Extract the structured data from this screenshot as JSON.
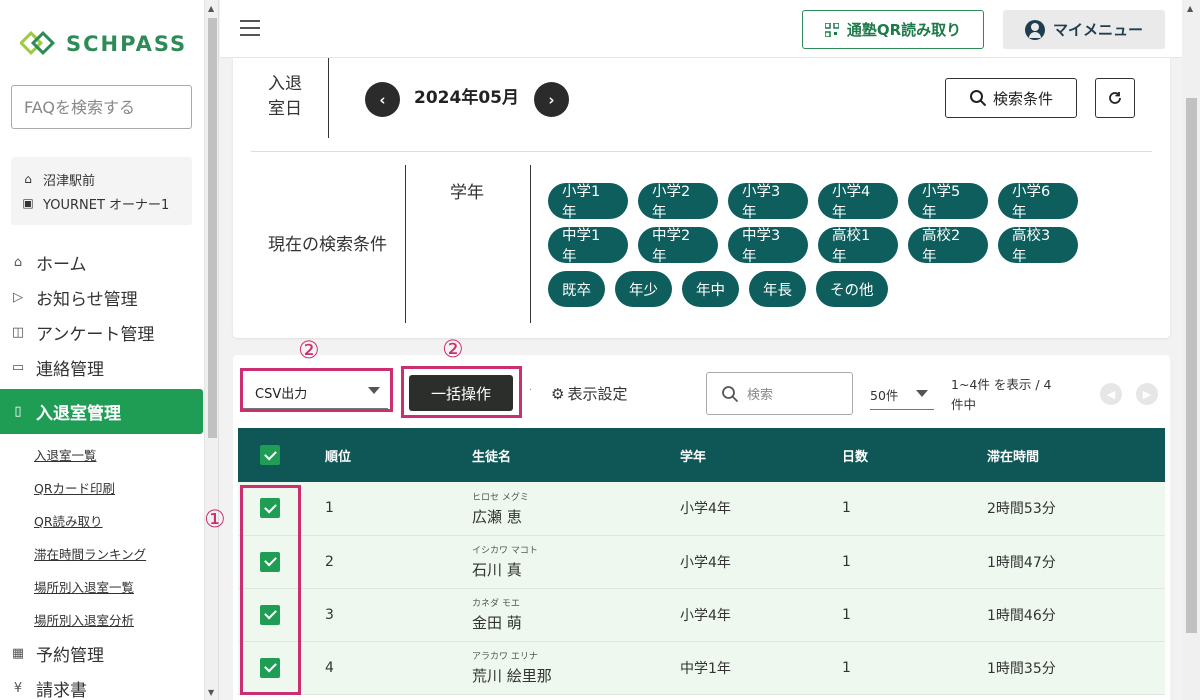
{
  "sidebar": {
    "logo_text": "SCHPASS",
    "faq_placeholder": "FAQを検索する",
    "school": "沼津駅前",
    "owner": "YOURNET オーナー1",
    "nav": [
      {
        "label": "ホーム",
        "icon": "home-icon"
      },
      {
        "label": "お知らせ管理",
        "icon": "triangle-icon"
      },
      {
        "label": "アンケート管理",
        "icon": "survey-icon"
      },
      {
        "label": "連絡管理",
        "icon": "chat-icon"
      },
      {
        "label": "入退室管理",
        "icon": "door-icon"
      }
    ],
    "sub_items": [
      "入退室一覧",
      "QRカード印刷",
      "QR読み取り",
      "滞在時間ランキング",
      "場所別入退室一覧",
      "場所別入退室分析"
    ],
    "nav_after": [
      {
        "label": "予約管理",
        "icon": "calendar-icon"
      },
      {
        "label": "請求書",
        "icon": "yen-icon"
      }
    ]
  },
  "header": {
    "qr_label": "通塾QR読み取り",
    "menu_label": "マイメニュー"
  },
  "search": {
    "date_label_1": "入退",
    "date_label_2": "室日",
    "month": "2024年05月",
    "prev": "‹",
    "next": "›",
    "cond_button": "検索条件",
    "current_label": "現在の検索条件",
    "grade_label": "学年",
    "grades": [
      "小学1年",
      "小学2年",
      "小学3年",
      "小学4年",
      "小学5年",
      "小学6年",
      "中学1年",
      "中学2年",
      "中学3年",
      "高校1年",
      "高校2年",
      "高校3年",
      "既卒",
      "年少",
      "年中",
      "年長",
      "その他"
    ]
  },
  "toolbar": {
    "csv_label": "CSV出力",
    "bulk_label": "一括操作",
    "dot": "·",
    "display_settings": "表示設定",
    "search_placeholder": "検索",
    "per_page": "50件",
    "range_1": "1~4件 を表示 / 4",
    "range_2": "件中"
  },
  "table": {
    "columns": [
      "順位",
      "生徒名",
      "学年",
      "日数",
      "滞在時間"
    ],
    "rows": [
      {
        "rank": "1",
        "kana": "ヒロセ メグミ",
        "name": "広瀬 恵",
        "grade": "小学4年",
        "days": "1",
        "time": "2時間53分"
      },
      {
        "rank": "2",
        "kana": "イシカワ マコト",
        "name": "石川 真",
        "grade": "小学4年",
        "days": "1",
        "time": "1時間47分"
      },
      {
        "rank": "3",
        "kana": "カネダ モエ",
        "name": "金田 萌",
        "grade": "小学4年",
        "days": "1",
        "time": "1時間46分"
      },
      {
        "rank": "4",
        "kana": "アラカワ エリナ",
        "name": "荒川 絵里那",
        "grade": "中学1年",
        "days": "1",
        "time": "1時間35分"
      }
    ]
  },
  "annotations": {
    "one": "①",
    "two_a": "②",
    "two_b": "②",
    "color": "#cc2e72"
  }
}
